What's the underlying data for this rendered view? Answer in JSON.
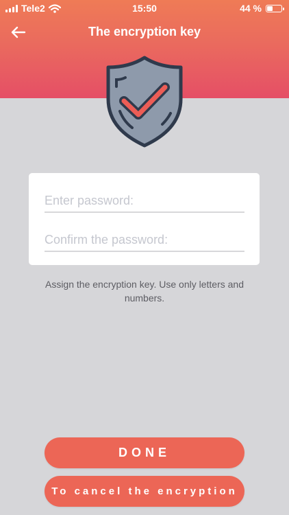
{
  "status_bar": {
    "carrier": "Tele2",
    "time": "15:50",
    "battery": "44 %",
    "battery_level": 0.44
  },
  "header": {
    "title": "The encryption key",
    "back_icon": "arrow-left-icon"
  },
  "illustration": {
    "icon": "shield-check-icon",
    "colors": {
      "shield": "#8e9aab",
      "outline": "#2f3a4c",
      "check": "#ec5d56"
    }
  },
  "form": {
    "password_placeholder": "Enter password:",
    "confirm_placeholder": "Confirm the password:",
    "password_value": "",
    "confirm_value": ""
  },
  "hint": "Assign the encryption key. Use only letters and numbers.",
  "buttons": {
    "done": "DONE",
    "cancel": "To cancel the encryption"
  },
  "colors": {
    "accent": "#ec6656",
    "header_top": "#ef7b56",
    "header_bottom": "#e54f66",
    "background": "#d6d6d9"
  }
}
